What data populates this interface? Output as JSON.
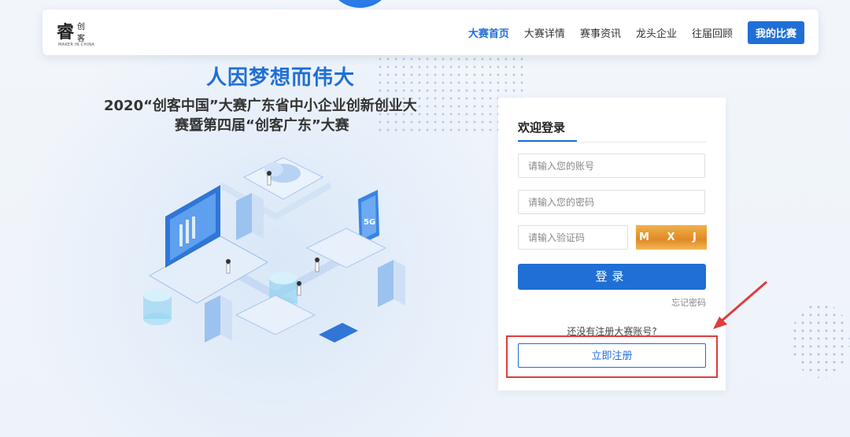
{
  "logo": {
    "mark": "睿",
    "text_line1": "创",
    "text_line2": "客",
    "sub": "MAKER IN CHINA"
  },
  "nav": {
    "items": [
      {
        "label": "大赛首页",
        "active": true
      },
      {
        "label": "大赛详情",
        "active": false
      },
      {
        "label": "赛事资讯",
        "active": false
      },
      {
        "label": "龙头企业",
        "active": false
      },
      {
        "label": "往届回顾",
        "active": false
      }
    ],
    "my_competition_button": "我的比赛"
  },
  "hero": {
    "title": "人因梦想而伟大",
    "subtitle_line1": "2020“创客中国”大赛广东省中小企业创新创业大",
    "subtitle_line2": "赛暨第四届“创客广东”大赛"
  },
  "illustration": {
    "badge_text": "5G"
  },
  "login": {
    "title": "欢迎登录",
    "account_placeholder": "请输入您的账号",
    "password_placeholder": "请输入您的密码",
    "captcha_placeholder": "请输入验证码",
    "captcha_text": "M X J L",
    "login_button": "登录",
    "forgot_password": "忘记密码",
    "no_account_prompt": "还没有注册大赛账号?",
    "register_button": "立即注册"
  },
  "colors": {
    "accent": "#1f6fd6",
    "highlight": "#e23b3b",
    "captcha": "#e08a26"
  }
}
